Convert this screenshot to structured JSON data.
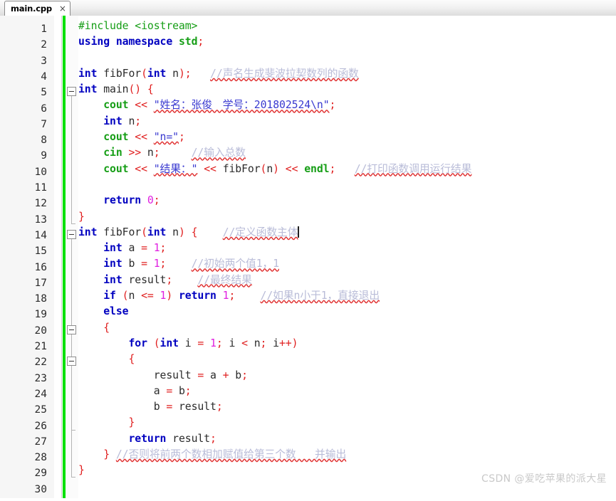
{
  "tab": {
    "filename": "main.cpp",
    "close_glyph": "×"
  },
  "editor": {
    "first_line": 1,
    "last_line": 30,
    "line_numbers": [
      1,
      2,
      3,
      4,
      5,
      6,
      7,
      8,
      9,
      10,
      11,
      12,
      13,
      14,
      15,
      16,
      17,
      18,
      19,
      20,
      21,
      22,
      23,
      24,
      25,
      26,
      27,
      28,
      29,
      30
    ]
  },
  "colors": {
    "keyword": "#0000c0",
    "preprocessor": "#169e16",
    "stdlib": "#169e16",
    "operator": "#e02020",
    "number": "#e020e0",
    "string": "#3a3ad0",
    "comment": "#b9bcd8",
    "changebar": "#00e000",
    "gutter_bg": "#f6f6f6",
    "editor_bg": "#ffffff"
  },
  "code": {
    "lines": [
      {
        "n": 1,
        "text": "#include <iostream>"
      },
      {
        "n": 2,
        "text": "using namespace std;"
      },
      {
        "n": 3,
        "text": ""
      },
      {
        "n": 4,
        "text": "int fibFor(int n);   //声名生成斐波拉契数列的函数"
      },
      {
        "n": 5,
        "text": "int main() {"
      },
      {
        "n": 6,
        "text": "    cout << \"姓名：张俊　学号：201802524\\n\";"
      },
      {
        "n": 7,
        "text": "    int n;"
      },
      {
        "n": 8,
        "text": "    cout << \"n=\";"
      },
      {
        "n": 9,
        "text": "    cin >> n;     //输入总数"
      },
      {
        "n": 10,
        "text": "    cout << \"结果：\" << fibFor(n) << endl;   //打印函数调用运行结果"
      },
      {
        "n": 11,
        "text": ""
      },
      {
        "n": 12,
        "text": "    return 0;"
      },
      {
        "n": 13,
        "text": "}"
      },
      {
        "n": 14,
        "text": "int fibFor(int n) {    //定义函数主体"
      },
      {
        "n": 15,
        "text": "    int a = 1;"
      },
      {
        "n": 16,
        "text": "    int b = 1;    //初始两个值1，1"
      },
      {
        "n": 17,
        "text": "    int result;    //最终结果"
      },
      {
        "n": 18,
        "text": "    if (n <= 1) return 1;    //如果n小于1，直接退出"
      },
      {
        "n": 19,
        "text": "    else"
      },
      {
        "n": 20,
        "text": "    {"
      },
      {
        "n": 21,
        "text": "        for (int i = 1; i < n; i++)"
      },
      {
        "n": 22,
        "text": "        {"
      },
      {
        "n": 23,
        "text": "            result = a + b;"
      },
      {
        "n": 24,
        "text": "            a = b;"
      },
      {
        "n": 25,
        "text": "            b = result;"
      },
      {
        "n": 26,
        "text": "        }"
      },
      {
        "n": 27,
        "text": "        return result;"
      },
      {
        "n": 28,
        "text": "    } //否则将前两个数相加赋值给第三个数   并输出"
      },
      {
        "n": 29,
        "text": "}"
      },
      {
        "n": 30,
        "text": ""
      }
    ],
    "comments": {
      "line4": "//声名生成斐波拉契数列的函数",
      "line9": "//输入总数",
      "line10": "//打印函数调用运行结果",
      "line14": "//定义函数主体",
      "line16": "//初始两个值1，1",
      "line17": "//最终结果",
      "line18": "//如果n小于1，直接退出",
      "line28": "//否则将前两个数相加赋值给第三个数   并输出"
    },
    "strings": {
      "line6": "\"姓名：张俊　学号：201802524\\n\"",
      "line8": "\"n=\"",
      "line10": "\"结果：\""
    }
  },
  "watermark": {
    "text": "CSDN @爱吃苹果的派大星"
  }
}
